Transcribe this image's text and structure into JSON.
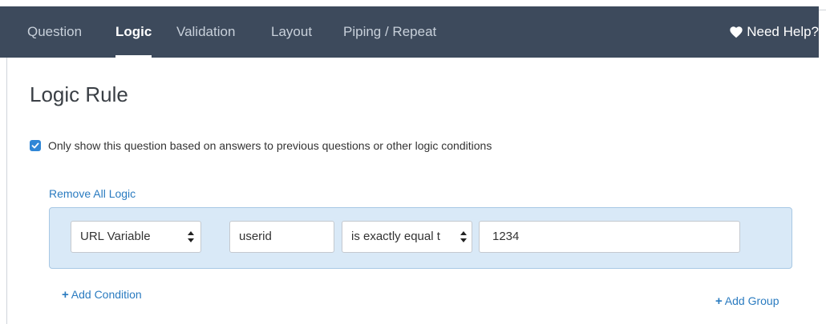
{
  "tabs": [
    {
      "label": "Question",
      "active": false
    },
    {
      "label": "Logic",
      "active": true
    },
    {
      "label": "Validation",
      "active": false
    },
    {
      "label": "Layout",
      "active": false
    },
    {
      "label": "Piping / Repeat",
      "active": false
    }
  ],
  "help": {
    "label": "Need Help?",
    "icon": "heart-icon"
  },
  "heading": "Logic Rule",
  "show_logic": {
    "checked": true,
    "label": "Only show this question based on answers to previous questions or other logic conditions"
  },
  "remove_all_logic": "Remove All Logic",
  "condition": {
    "source": "URL Variable",
    "variable": "userid",
    "operator": "is exactly equal t",
    "value": "1234"
  },
  "add_condition": "Add Condition",
  "add_group": "Add Group",
  "colors": {
    "nav_bg": "#3d4a5c",
    "accent": "#2a7bc0",
    "group_bg": "#d9e9f7"
  }
}
